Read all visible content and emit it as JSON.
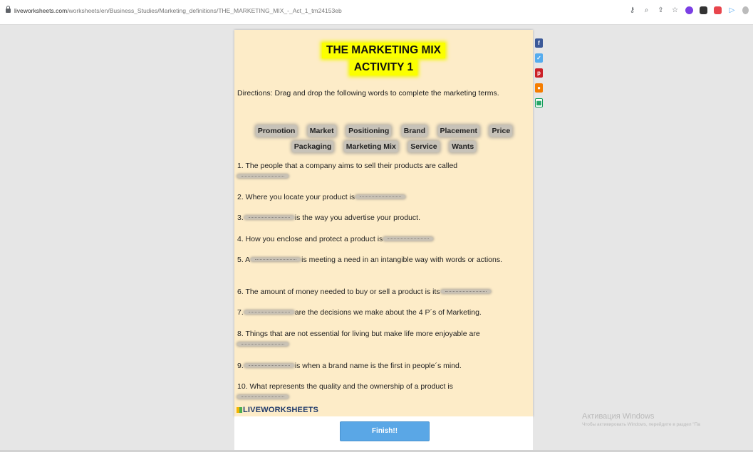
{
  "browser": {
    "url_host": "liveworksheets.com",
    "url_path": "/worksheets/en/Business_Studies/Marketing_definitions/THE_MARKETING_MIX_-_Act_1_tm24153eb"
  },
  "worksheet": {
    "title_line1": "THE MARKETING MIX",
    "title_line2": "ACTIVITY 1",
    "directions": "Directions: Drag and drop the following words to complete the marketing terms.",
    "word_bank": [
      "Promotion",
      "Market",
      "Positioning",
      "Brand",
      "Placement",
      "Price",
      "Packaging",
      "Marketing Mix",
      "Service",
      "Wants"
    ],
    "questions": {
      "q1": "1. The people that a company aims to sell their products are called",
      "q2": "2. Where you locate your product is",
      "q3_pre": "3.",
      "q3_post": "is the way you advertise your product.",
      "q4": "4. How you enclose and protect a product is",
      "q5_pre": "5. A",
      "q5_post": "is meeting a need in an intangible way with words or actions.",
      "q6": "6. The amount of money needed to buy or sell a product is its",
      "q7_pre": "7.",
      "q7_post": "are the decisions we make about the 4 P´s of Marketing.",
      "q8": "8. Things that are not essential for living but make life more enjoyable are",
      "q9_pre": "9.",
      "q9_post": "is when a brand name is the first in people´s mind.",
      "q10": "10. What represents the quality and the ownership of a product is"
    },
    "logo": "LIVEWORKSHEETS",
    "finish_label": "Finish!!"
  },
  "share_icons": [
    "facebook-icon",
    "twitter-icon",
    "pinterest-icon",
    "blogger-icon",
    "google-classroom-icon"
  ],
  "colors": {
    "sheet_bg": "#fdecc8",
    "title_highlight": "#fbff00",
    "finish_button": "#5aa7e6",
    "facebook": "#3b5998",
    "twitter": "#55acee",
    "pinterest": "#cb2027",
    "blogger": "#f57d00",
    "classroom": "#0f9d58"
  },
  "watermark": {
    "line1": "Активация Windows",
    "line2": "Чтобы активировать Windows, перейдите в раздел \"Па"
  }
}
